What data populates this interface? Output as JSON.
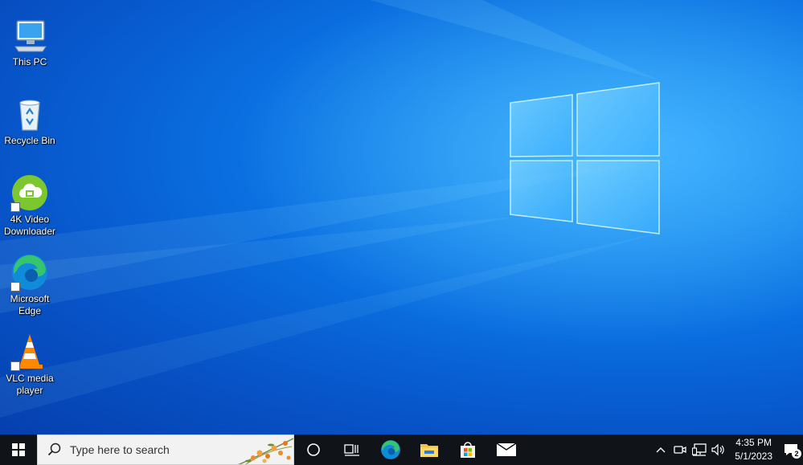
{
  "desktop": {
    "icons": [
      {
        "label": "This PC",
        "icon": "this-pc-icon"
      },
      {
        "label": "Recycle Bin",
        "icon": "recycle-bin-icon"
      },
      {
        "label": "4K Video\nDownloader",
        "icon": "4k-video-downloader-icon"
      },
      {
        "label": "Microsoft\nEdge",
        "icon": "edge-icon"
      },
      {
        "label": "VLC media\nplayer",
        "icon": "vlc-icon"
      }
    ]
  },
  "taskbar": {
    "search_placeholder": "Type here to search",
    "pinned": [
      "cortana-icon",
      "task-view-icon",
      "edge-icon",
      "file-explorer-icon",
      "microsoft-store-icon",
      "mail-icon"
    ],
    "tray": [
      "chevron-up-icon",
      "meet-now-icon",
      "network-icon",
      "volume-icon"
    ],
    "clock": {
      "time": "4:35 PM",
      "date": "5/1/2023"
    },
    "notification_count": "2"
  },
  "colors": {
    "wallpaper": "#0a6fe0",
    "taskbar": "#101418",
    "accent": "#2aa0ff"
  }
}
